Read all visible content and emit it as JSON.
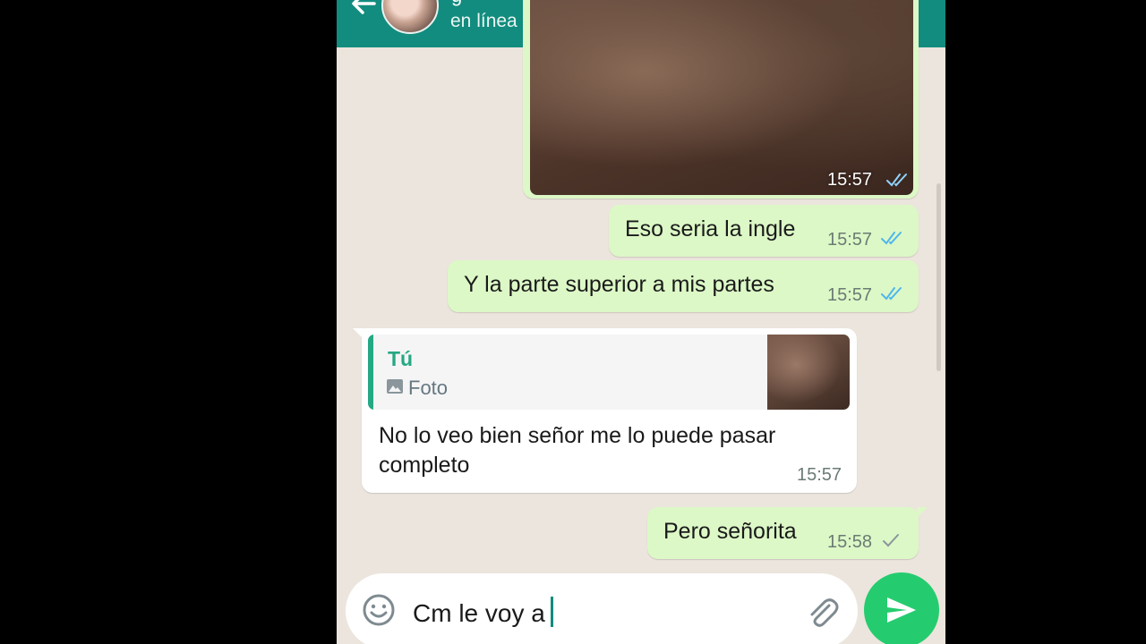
{
  "header": {
    "contact_name": "g",
    "status": "en línea"
  },
  "messages": [
    {
      "type": "photo",
      "direction": "out",
      "time": "15:57",
      "ticks": "read"
    },
    {
      "type": "text",
      "direction": "out",
      "text": "Eso seria la ingle",
      "time": "15:57",
      "ticks": "read"
    },
    {
      "type": "text",
      "direction": "out",
      "text": "Y la parte superior a mis partes",
      "time": "15:57",
      "ticks": "read"
    },
    {
      "type": "reply",
      "direction": "in",
      "quote": {
        "author": "Tú",
        "kind": "Foto"
      },
      "text": "No lo veo bien señor me lo puede pasar completo",
      "time": "15:57"
    },
    {
      "type": "text",
      "direction": "out",
      "text": "Pero señorita",
      "time": "15:58",
      "ticks": "sent"
    }
  ],
  "composer": {
    "value": "Cm le voy a"
  },
  "icons": [
    "back-arrow-icon",
    "video-call-icon",
    "phone-icon",
    "more-vert-icon",
    "emoji-icon",
    "attach-icon",
    "send-icon",
    "photo-icon",
    "double-check-icon",
    "single-check-icon"
  ],
  "colors": {
    "header": "#128c7e",
    "chat_background": "#ece5dd",
    "outgoing_bubble": "#dcf8c6",
    "incoming_bubble": "#ffffff",
    "read_ticks": "#4fb6ec",
    "send_button": "#25cc6f",
    "quote_accent": "#25a884"
  }
}
